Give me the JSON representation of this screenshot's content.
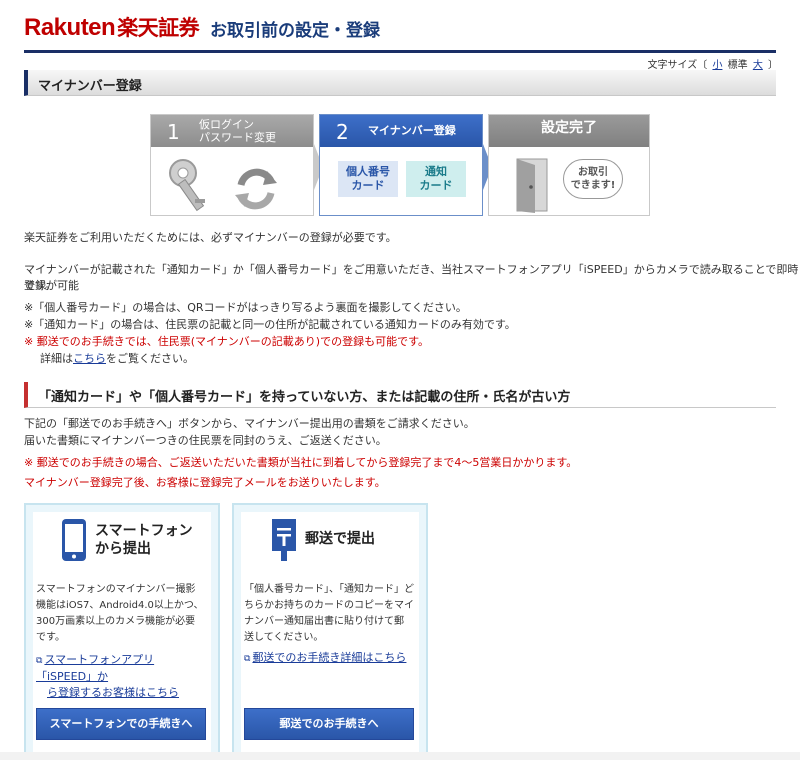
{
  "header": {
    "logo_latin": "Rakuten",
    "logo_jp": "楽天証券",
    "title": "お取引前の設定・登録"
  },
  "font_size": {
    "prefix": "文字サイズ〔",
    "small": "小",
    "normal": "標準",
    "large": "大",
    "suffix": "〕"
  },
  "section_title": "マイナンバー登録",
  "steps": [
    {
      "num": "1",
      "label_line1": "仮ログイン",
      "label_line2": "パスワード変更"
    },
    {
      "num": "2",
      "label": "マイナンバー登録",
      "card_a_line1": "個人番号",
      "card_a_line2": "カード",
      "card_b_line1": "通知",
      "card_b_line2": "カード"
    },
    {
      "label": "設定完了",
      "bubble_line1": "お取引",
      "bubble_line2": "できます!"
    }
  ],
  "intro": {
    "line1": "楽天証券をご利用いただくためには、必ずマイナンバーの登録が必要です。",
    "line2a": "マイナンバーが記載された「通知カード」か「個人番号カード」をご用意いただき、当社スマートフォンアプリ「iSPEED」からカメラで読み取ることで即時登録が可能",
    "line2b": "です。",
    "note1": "※「個人番号カード」の場合は、QRコードがはっきり写るよう裏面を撮影してください。",
    "note2": "※「通知カード」の場合は、住民票の記載と同一の住所が記載されている通知カードのみ有効です。",
    "note3": "※ 郵送でのお手続きでは、住民票(マイナンバーの記載あり)での登録も可能です。",
    "note4_pre": "詳細は",
    "note4_link": "こちら",
    "note4_post": "をご覧ください。"
  },
  "subheading": "「通知カード」や「個人番号カード」を持っていない方、または記載の住所・氏名が古い方",
  "mail_info": {
    "line1": "下記の「郵送でのお手続きへ」ボタンから、マイナンバー提出用の書類をご請求ください。",
    "line2": "届いた書類にマイナンバーつきの住民票を同封のうえ、ご返送ください。",
    "line3": "※ 郵送でのお手続きの場合、ご返送いただいた書類が当社に到着してから登録完了まで4〜5営業日かかります。",
    "line4": "マイナンバー登録完了後、お客様に登録完了メールをお送りいたします。"
  },
  "boxes": {
    "smartphone": {
      "title_line1": "スマートフォン",
      "title_line2": "から提出",
      "body_line1": "スマートフォンのマイナンバー撮影",
      "body_line2": "機能はiOS7、Android4.0以上かつ、",
      "body_line3": "300万画素以上のカメラ機能が必要",
      "body_line4": "です。",
      "link_line1": "スマートフォンアプリ「iSPEED」か",
      "link_line2": "ら登録するお客様はこちら",
      "button": "スマートフォンでの手続きへ"
    },
    "mail": {
      "title": "郵送で提出",
      "body_line1": "「個人番号カード」、「通知カード」ど",
      "body_line2": "ちらかお持ちのカードのコピーをマイ",
      "body_line3": "ナンバー通知届出書に貼り付けて郵",
      "body_line4": "送してください。",
      "link": "郵送でのお手続き詳細はこちら",
      "button": "郵送でのお手続きへ"
    }
  },
  "colors": {
    "brand_red": "#bf0000",
    "navy": "#1a2f66",
    "button_blue": "#2a56a8",
    "notice_red": "#cc0000"
  }
}
